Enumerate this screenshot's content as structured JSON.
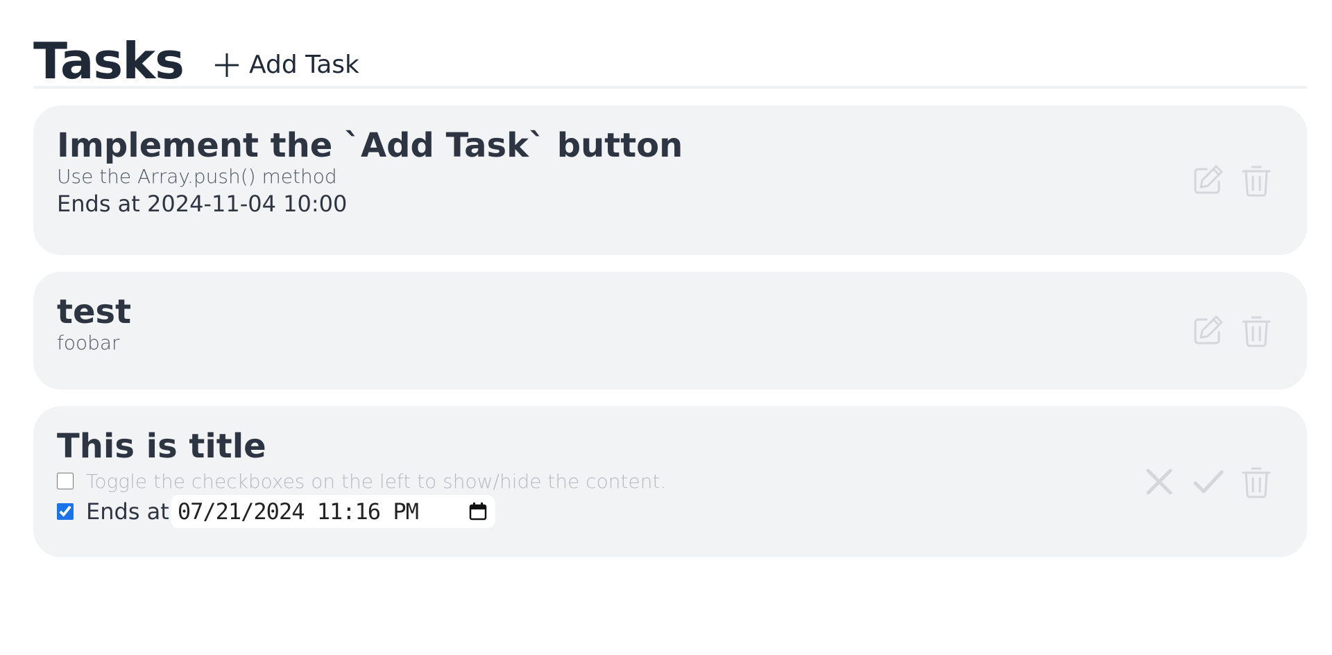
{
  "header": {
    "title": "Tasks",
    "add_button_label": "Add Task"
  },
  "tasks": [
    {
      "title": "Implement the `Add Task` button",
      "description": "Use the Array.push() method",
      "ends": "Ends at 2024-11-04 10:00"
    },
    {
      "title": "test",
      "description": "foobar"
    },
    {
      "title": "This is title",
      "editing": true,
      "description_placeholder": "Toggle the checkboxes on the left to show/hide the content.",
      "description_enabled": false,
      "ends_enabled": true,
      "ends_label": "Ends at",
      "ends_value": "07/21/2024 11:16 PM"
    }
  ],
  "icons": {
    "add": "plus-icon",
    "edit": "pencil-square-icon",
    "delete": "trash-icon",
    "cancel": "x-icon",
    "confirm": "check-icon",
    "calendar": "calendar-icon"
  },
  "colors": {
    "card_bg": "#f2f3f5",
    "icon_muted": "#d4d6da",
    "checkbox_accent": "#1a73e8"
  }
}
